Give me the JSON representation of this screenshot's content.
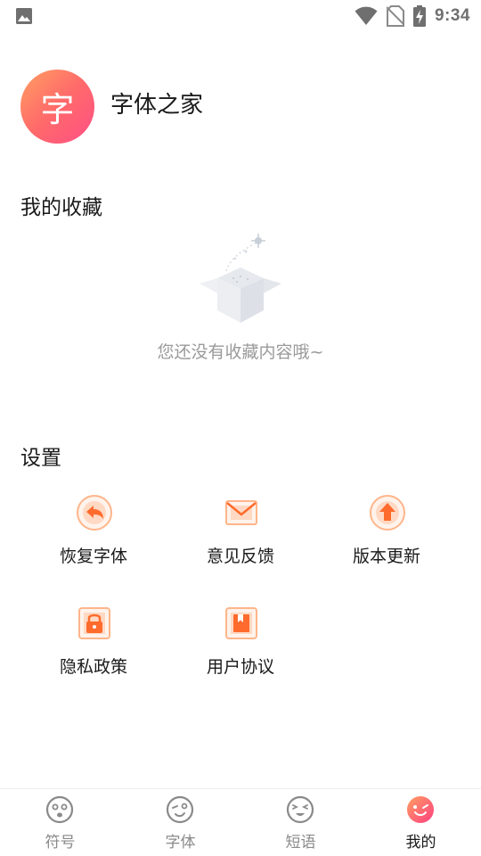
{
  "status_bar": {
    "time": "9:34",
    "icons": [
      "gallery-icon",
      "wifi-icon",
      "no-sim-icon",
      "battery-charging-icon"
    ]
  },
  "profile": {
    "avatar_char": "字",
    "app_name": "字体之家"
  },
  "favorites": {
    "title": "我的收藏",
    "empty_text": "您还没有收藏内容哦~",
    "empty_icon": "empty-box-icon"
  },
  "settings": {
    "title": "设置",
    "items": [
      {
        "label": "恢复字体",
        "icon": "restore-icon"
      },
      {
        "label": "意见反馈",
        "icon": "feedback-mail-icon"
      },
      {
        "label": "版本更新",
        "icon": "update-arrow-icon"
      },
      {
        "label": "隐私政策",
        "icon": "privacy-lock-icon"
      },
      {
        "label": "用户协议",
        "icon": "user-agreement-icon"
      }
    ]
  },
  "bottom_nav": {
    "items": [
      {
        "label": "符号",
        "icon": "face-symbol-icon",
        "active": false
      },
      {
        "label": "字体",
        "icon": "face-wink-icon",
        "active": false
      },
      {
        "label": "短语",
        "icon": "face-squint-icon",
        "active": false
      },
      {
        "label": "我的",
        "icon": "face-mine-icon",
        "active": true
      }
    ]
  },
  "colors": {
    "accent_orange": "#ff6b2c",
    "avatar_gradient_start": "#ff9f62",
    "avatar_gradient_end": "#ff4f86",
    "muted_text": "#9a9a9a"
  }
}
